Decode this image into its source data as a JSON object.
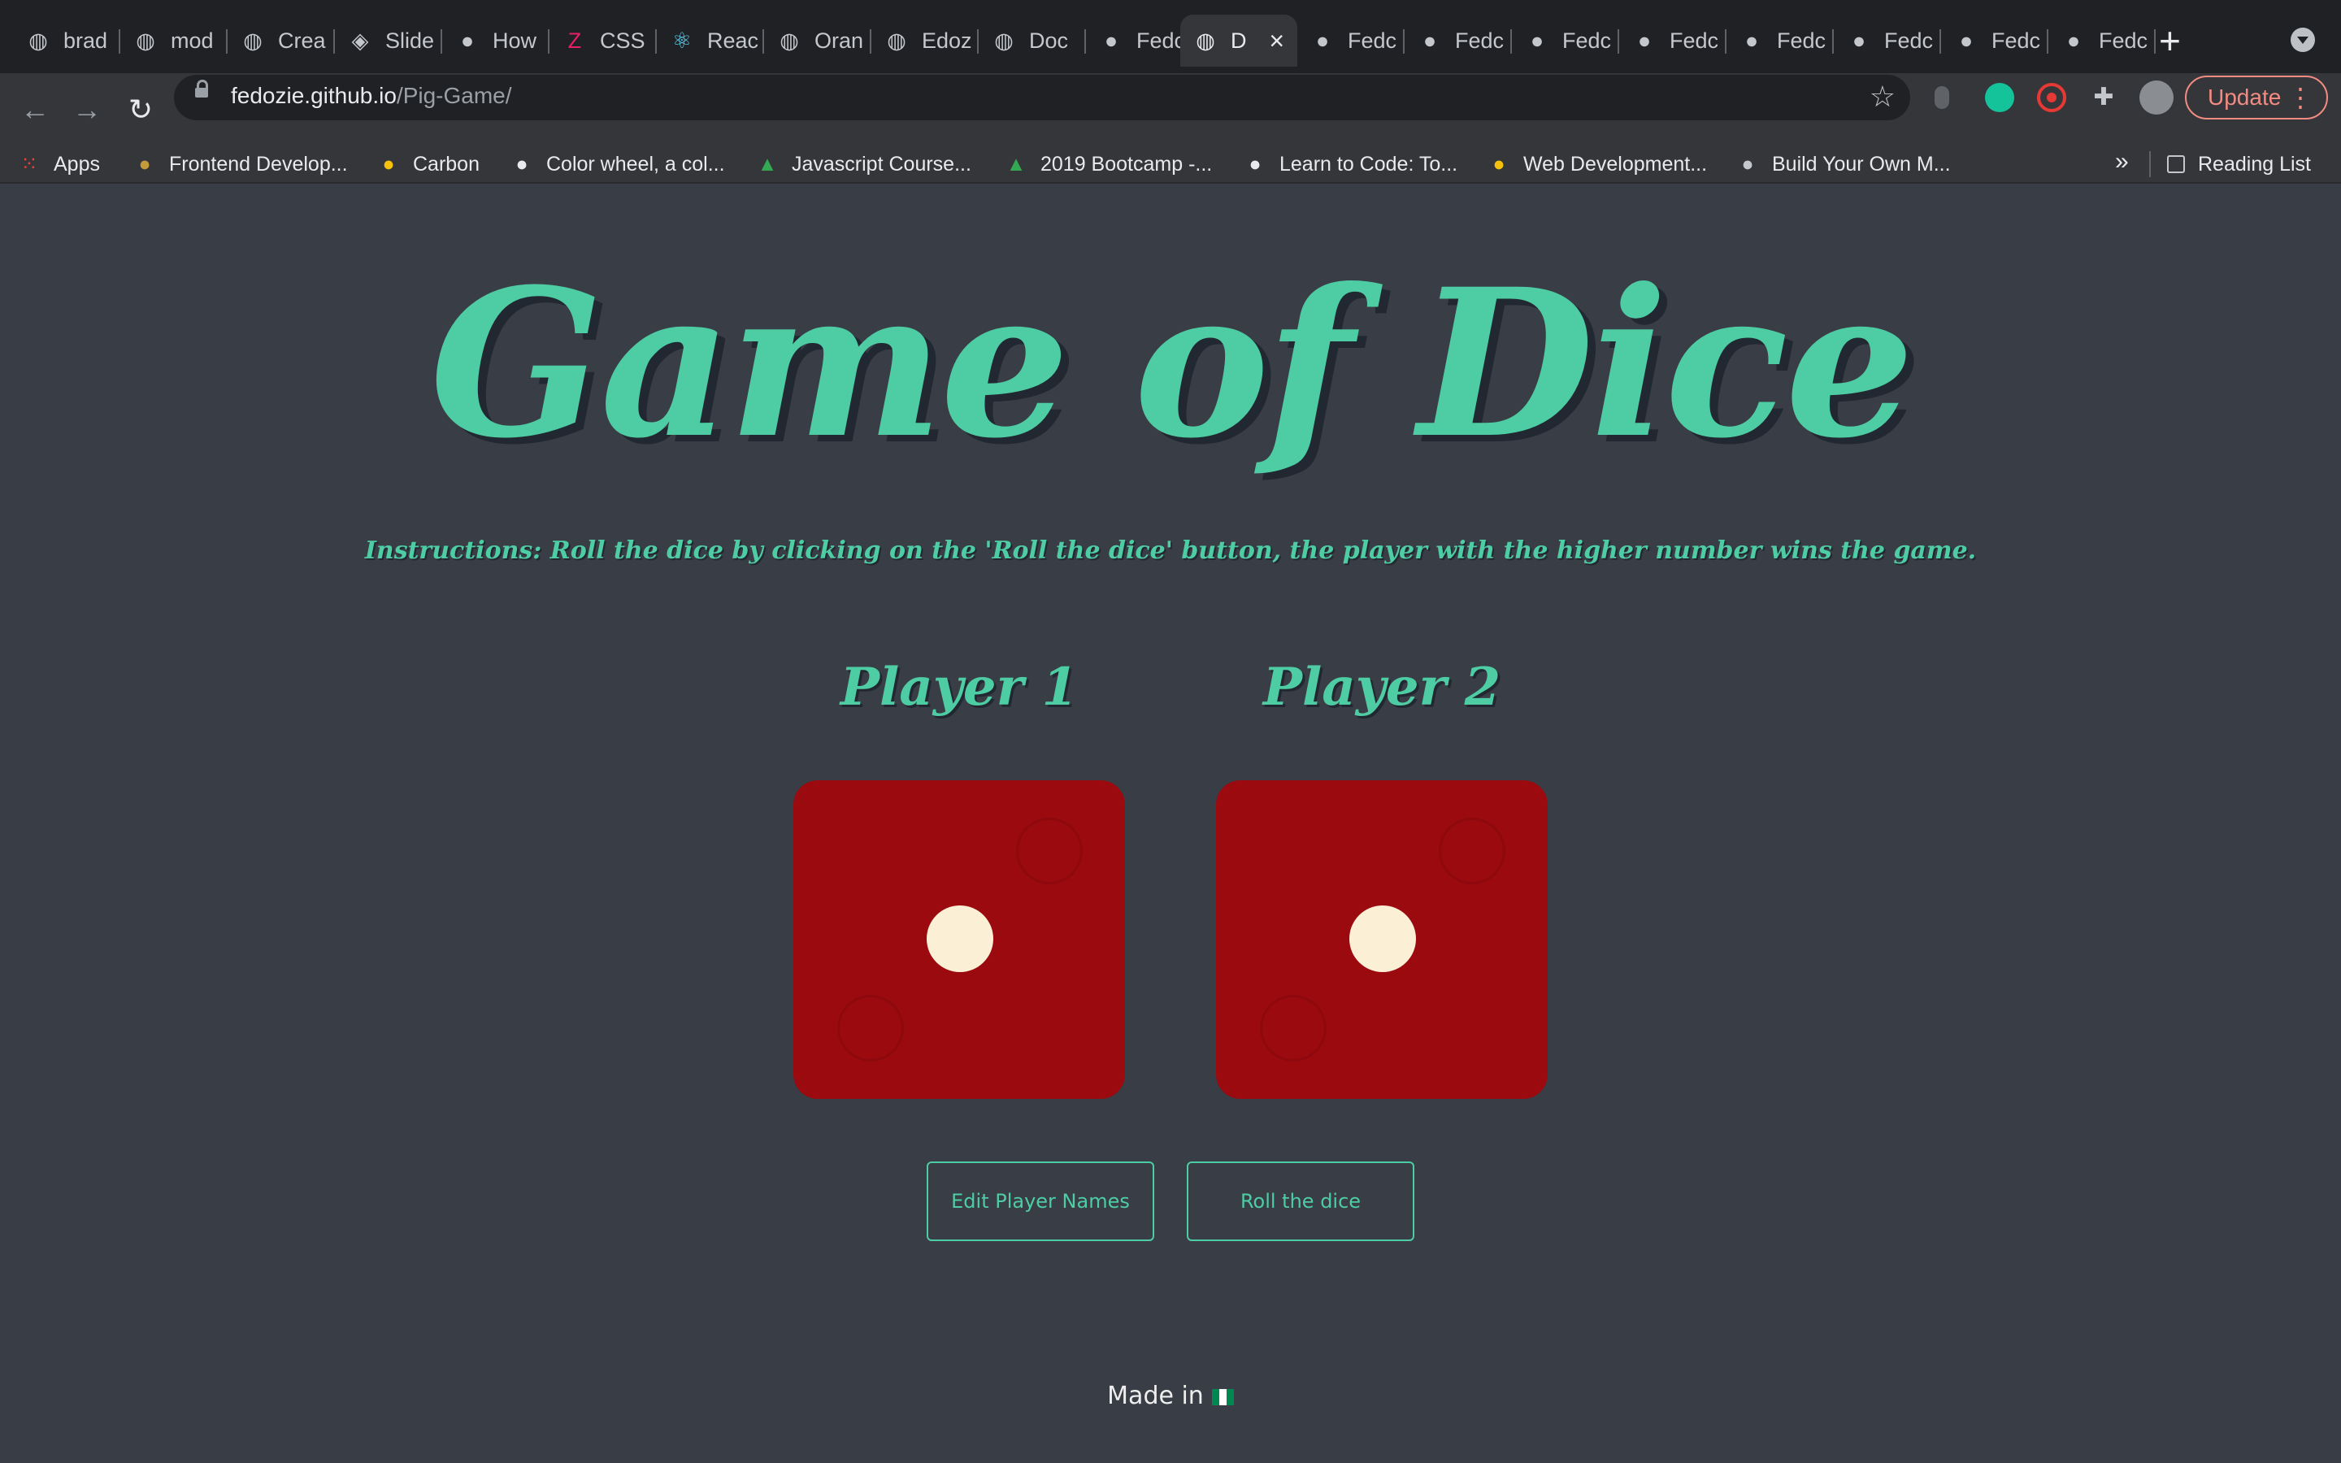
{
  "browser": {
    "tabs": [
      {
        "label": "brad",
        "icon": "globe-icon"
      },
      {
        "label": "mod",
        "icon": "globe-icon"
      },
      {
        "label": "Crea",
        "icon": "globe-icon"
      },
      {
        "label": "Slide",
        "icon": "codepen-icon"
      },
      {
        "label": "How",
        "icon": "avatar-icon"
      },
      {
        "label": "CSS",
        "icon": "z-icon"
      },
      {
        "label": "Reac",
        "icon": "react-icon"
      },
      {
        "label": "Oran",
        "icon": "globe-icon"
      },
      {
        "label": "Edoz",
        "icon": "globe-icon"
      },
      {
        "label": "Doc",
        "icon": "globe-icon"
      },
      {
        "label": "Fedc",
        "icon": "github-icon"
      },
      {
        "label": "D",
        "icon": "globe-icon",
        "active": true
      },
      {
        "label": "Fedc",
        "icon": "github-icon"
      },
      {
        "label": "Fedc",
        "icon": "github-icon"
      },
      {
        "label": "Fedc",
        "icon": "github-icon"
      },
      {
        "label": "Fedc",
        "icon": "github-icon"
      },
      {
        "label": "Fedc",
        "icon": "github-icon"
      },
      {
        "label": "Fedc",
        "icon": "github-icon"
      },
      {
        "label": "Fedc",
        "icon": "github-icon"
      },
      {
        "label": "Fedc",
        "icon": "github-icon"
      }
    ],
    "url_host": "fedozie.github.io",
    "url_path": "/Pig-Game/",
    "update_label": "Update",
    "bookmarks": [
      {
        "label": "Apps",
        "icon": "apps-grid-icon"
      },
      {
        "label": "Frontend Develop...",
        "icon": "graduation-cap-icon"
      },
      {
        "label": "Carbon",
        "icon": "carbon-icon"
      },
      {
        "label": "Color wheel, a col...",
        "icon": "color-wheel-icon"
      },
      {
        "label": "Javascript Course...",
        "icon": "google-drive-icon"
      },
      {
        "label": "2019 Bootcamp -...",
        "icon": "google-drive-icon"
      },
      {
        "label": "Learn to Code: To...",
        "icon": "code-icon"
      },
      {
        "label": "Web Development...",
        "icon": "bee-icon"
      },
      {
        "label": "Build Your Own M...",
        "icon": "globe-icon"
      }
    ],
    "bookmarks_more": "»",
    "reading_list": "Reading List"
  },
  "page": {
    "title": "Game of Dice",
    "instructions": "Instructions: Roll the dice by clicking on the 'Roll the dice' button, the player with the higher number wins the game.",
    "player1": {
      "name": "Player 1",
      "die_value": 1
    },
    "player2": {
      "name": "Player 2",
      "die_value": 1
    },
    "edit_button": "Edit Player Names",
    "roll_button": "Roll the dice",
    "footer_text": "Made in"
  },
  "colors": {
    "background": "#393e46",
    "accent": "#4ecca3",
    "die": "#9a0a0f",
    "pip": "#fbf0d6"
  }
}
